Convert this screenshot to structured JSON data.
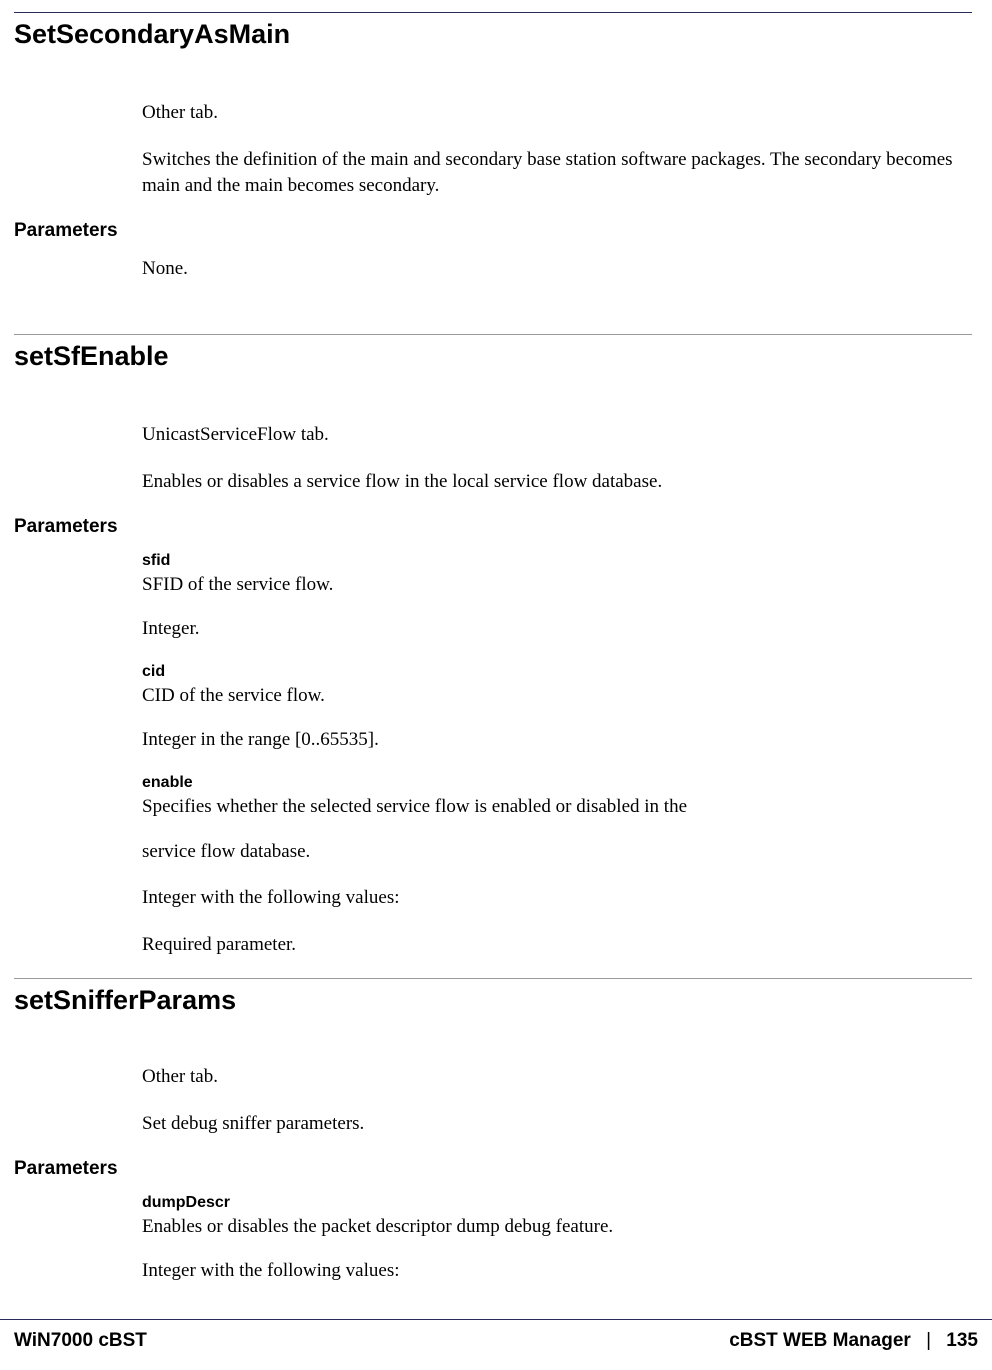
{
  "sections": [
    {
      "title": "SetSecondaryAsMain",
      "intro": [
        "Other tab.",
        "Switches the definition of the main and secondary base station software packages. The secondary becomes main and the main becomes secondary."
      ],
      "parametersHeading": "Parameters",
      "parametersNone": "None.",
      "params": []
    },
    {
      "title": "setSfEnable",
      "intro": [
        "UnicastServiceFlow tab.",
        "Enables or disables a service flow in the local service flow database."
      ],
      "parametersHeading": "Parameters",
      "params": [
        {
          "name": "sfid",
          "lines": [
            "SFID of the service flow.",
            "Integer."
          ]
        },
        {
          "name": "cid",
          "lines": [
            "CID of the service flow.",
            "Integer in the range [0..65535]."
          ]
        },
        {
          "name": "enable",
          "lines": [
            "Specifies whether the selected service flow is enabled or disabled in the",
            "service flow database.",
            "Integer with the following values:",
            "Required parameter."
          ]
        }
      ]
    },
    {
      "title": "setSnifferParams",
      "intro": [
        "Other tab.",
        "Set debug sniffer parameters."
      ],
      "parametersHeading": "Parameters",
      "params": [
        {
          "name": "dumpDescr",
          "lines": [
            "Enables or disables the packet descriptor dump debug feature.",
            "Integer with the following values:"
          ]
        }
      ]
    }
  ],
  "footer": {
    "left": "WiN7000 cBST",
    "rightLabel": "cBST WEB Manager",
    "separator": "|",
    "pageNumber": "135"
  }
}
